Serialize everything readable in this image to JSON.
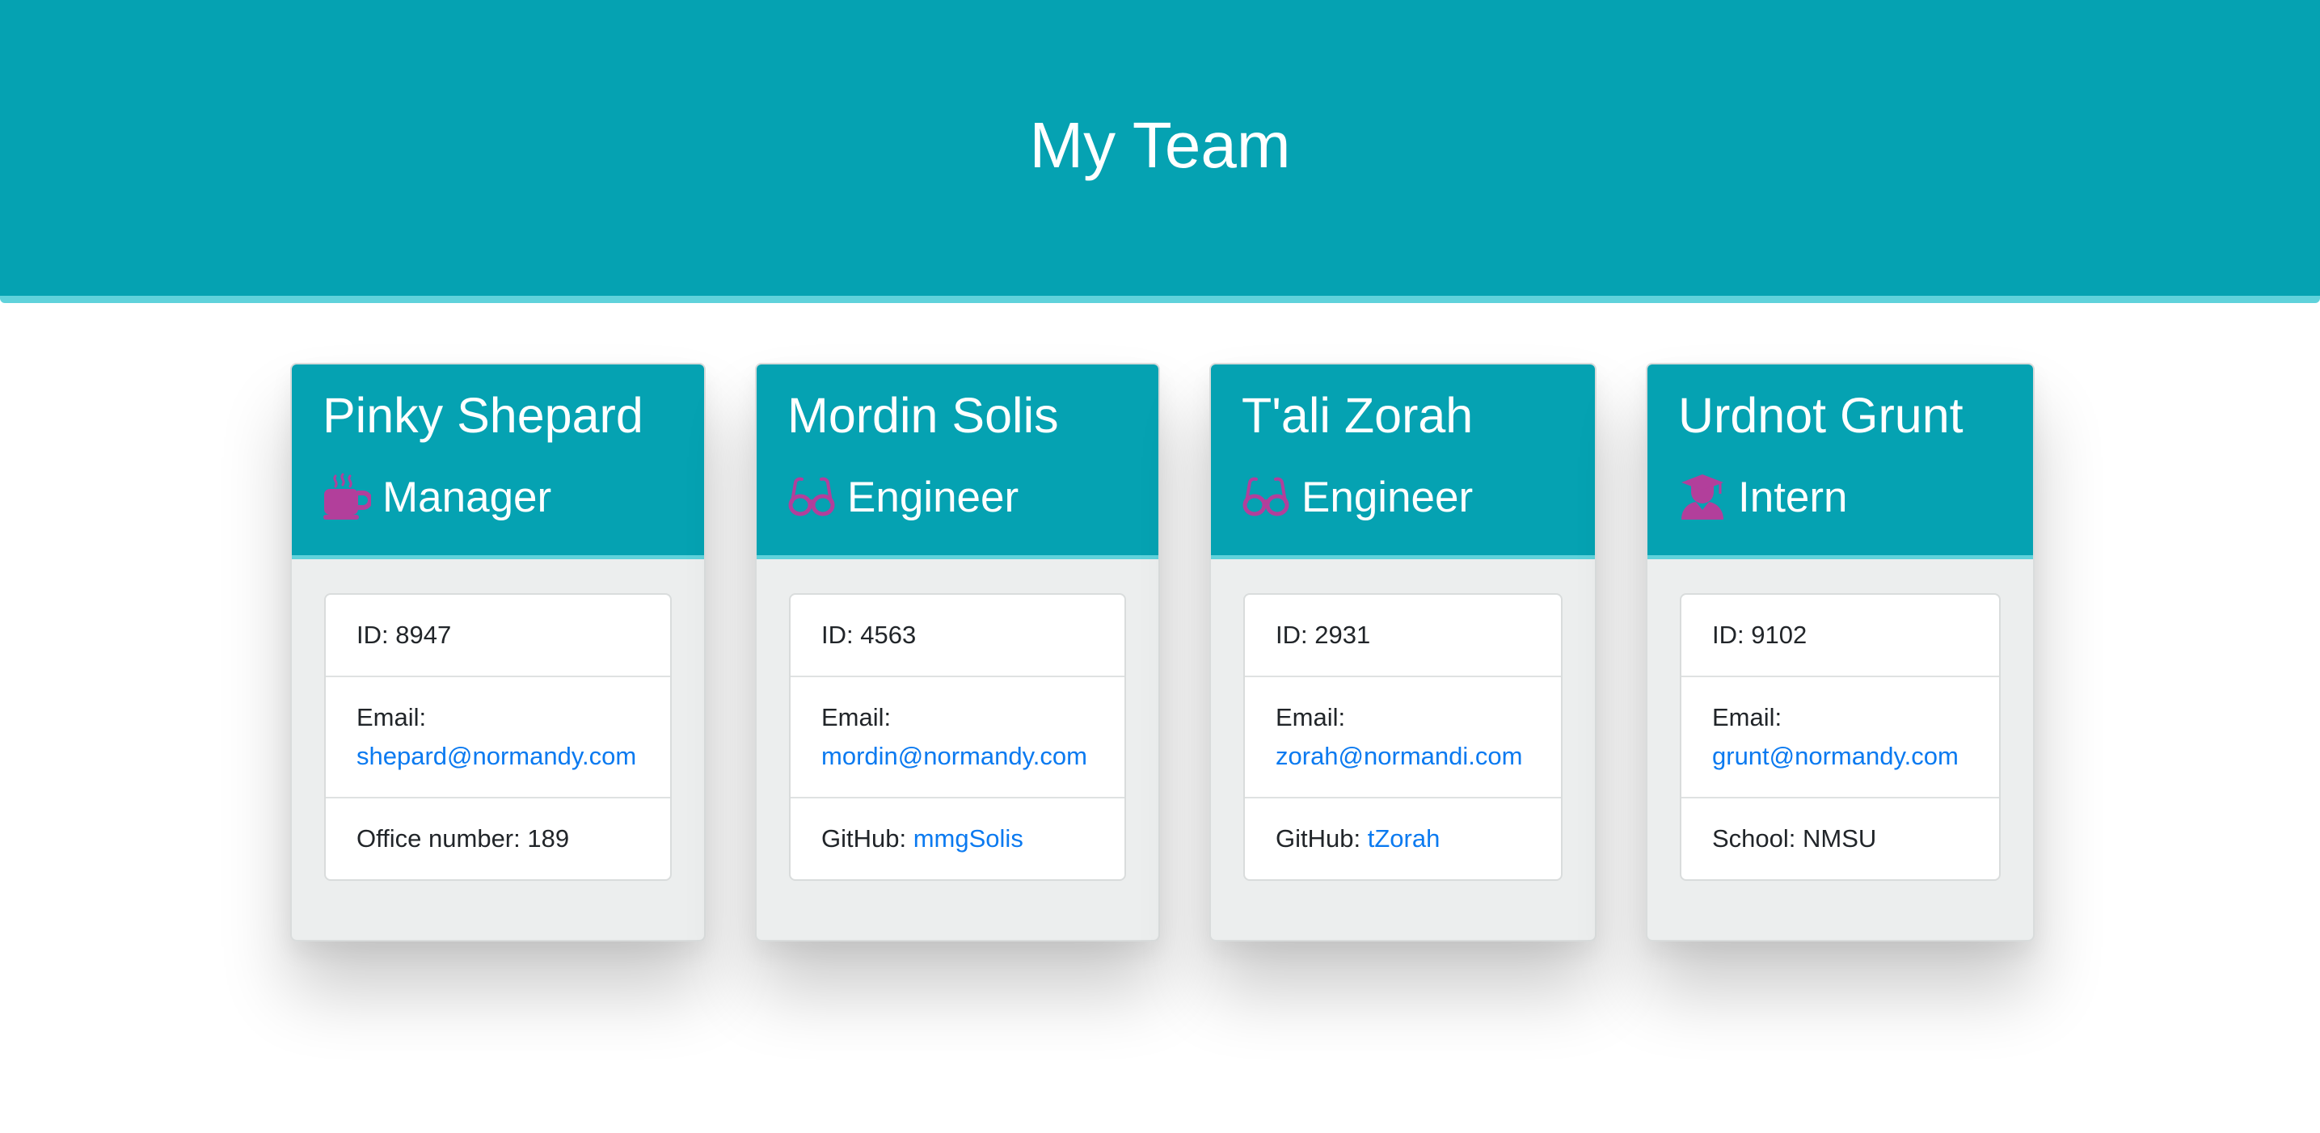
{
  "header": {
    "title": "My Team"
  },
  "colors": {
    "header_bg": "#05a2b2",
    "header_border": "#5fd2db",
    "icon": "#b23f9b",
    "link": "#0b7af0"
  },
  "cards": [
    {
      "name": "Pinky Shepard",
      "role": "Manager",
      "icon": "coffee-mug-icon",
      "id_label": "ID: 8947",
      "email_label": "Email:",
      "email": "shepard@normandy.com",
      "extra_label": "Office number: 189"
    },
    {
      "name": "Mordin Solis",
      "role": "Engineer",
      "icon": "glasses-icon",
      "id_label": "ID: 4563",
      "email_label": "Email:",
      "email": "mordin@normandy.com",
      "extra_label": "GitHub:",
      "extra_link": "mmgSolis"
    },
    {
      "name": "T'ali Zorah",
      "role": "Engineer",
      "icon": "glasses-icon",
      "id_label": "ID: 2931",
      "email_label": "Email:",
      "email": "zorah@normandi.com",
      "extra_label": "GitHub:",
      "extra_link": "tZorah"
    },
    {
      "name": "Urdnot Grunt",
      "role": "Intern",
      "icon": "graduate-icon",
      "id_label": "ID: 9102",
      "email_label": "Email:",
      "email": "grunt@normandy.com",
      "extra_label": "School: NMSU"
    }
  ]
}
